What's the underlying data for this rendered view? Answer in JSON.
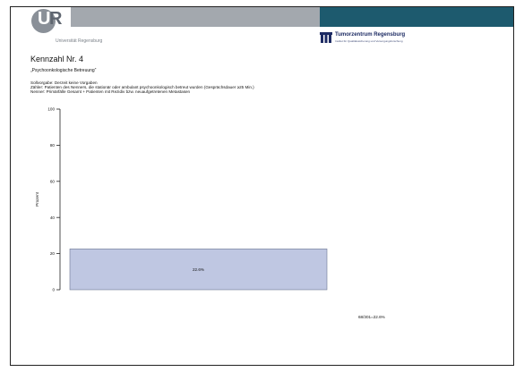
{
  "header": {
    "university_logo_text": "UR",
    "university_name": "Universität Regensburg",
    "center_name": "Tumorzentrum Regensburg",
    "center_subtitle": "Institut für Qualitätssicherung und Versorgungsforschung",
    "colors": {
      "gray_bar": "#a3a8ae",
      "teal_bar": "#1d5a6e",
      "logo": "#8a9098",
      "brand_blue": "#1d2b63"
    }
  },
  "slide": {
    "title": "Kennzahl Nr. 4",
    "subtitle": "„Psychoonkologische Betreuung“",
    "sollvorgabe": "Sollvorgabe: Derzeit keine  Vorgaben",
    "zaehler": "Zähler: Patienten des Nenners, die stationär oder ambulant  psychoonkologisch betreut wurden (Gesprächsdauer  ≥25    Min.)",
    "nenner": "Nenner: Primärfälle Gesamt +   Patienten mit Rezidiv bzw. neuaufgetretenen    Metastasen",
    "footnote": "68/301=22.6%"
  },
  "chart_data": {
    "type": "bar",
    "categories": [
      ""
    ],
    "values": [
      22.6
    ],
    "data_labels": [
      "22.6%"
    ],
    "title": "",
    "xlabel": "",
    "ylabel": "Prozent",
    "ylim": [
      0,
      100
    ],
    "yticks": [
      0,
      20,
      40,
      60,
      80,
      100
    ],
    "grid": false,
    "legend": "none",
    "bar_color": "#bfc7e2",
    "bar_edge": "#6b7591"
  }
}
